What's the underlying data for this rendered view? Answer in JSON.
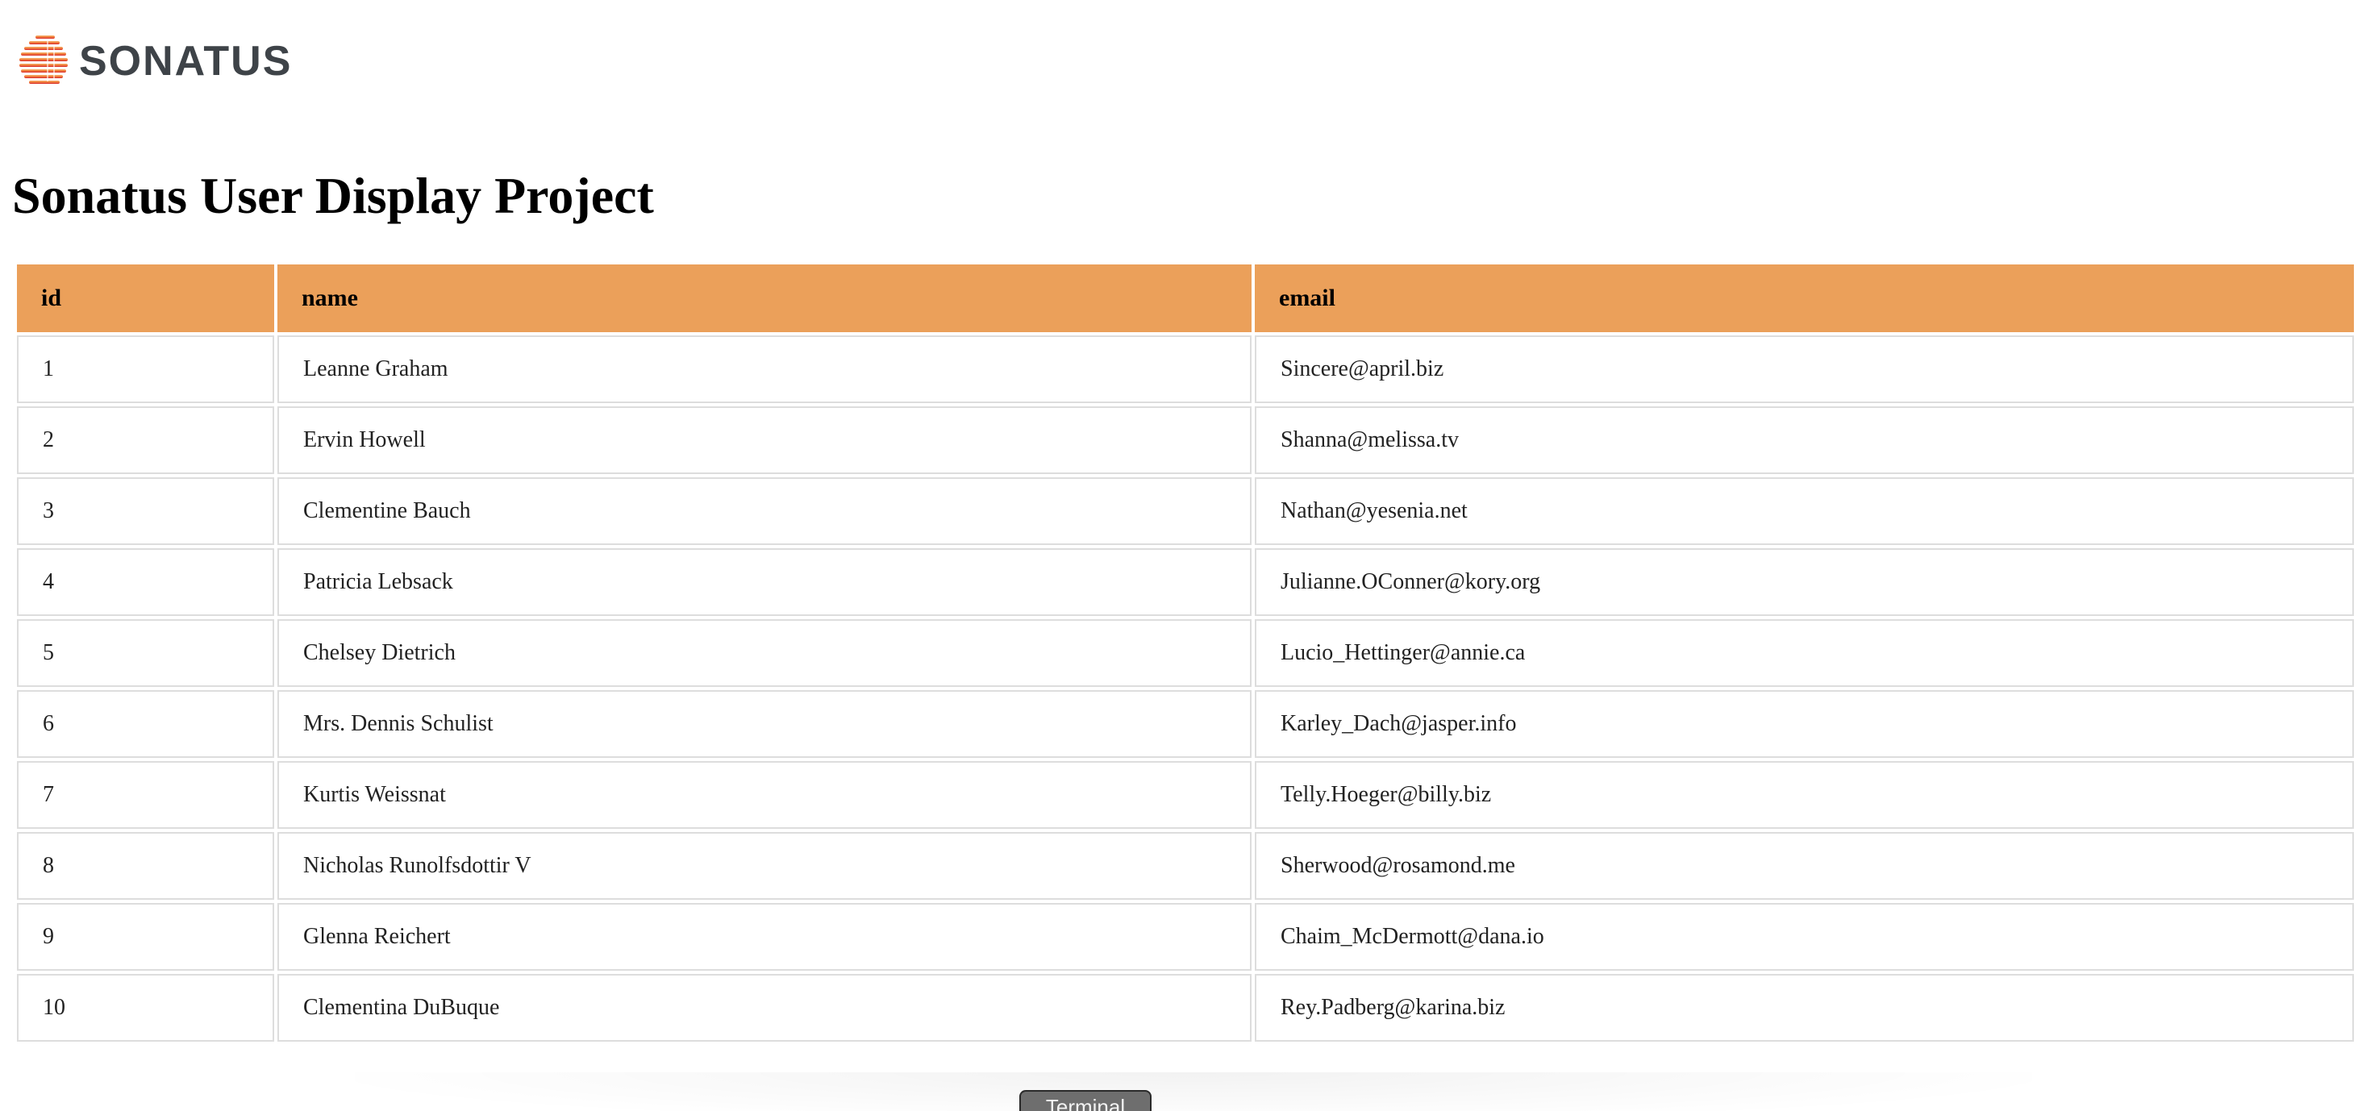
{
  "brand": {
    "name": "SONATUS",
    "colors": {
      "stripe_top": "#f4a05a",
      "stripe_bottom": "#d7262e",
      "wordmark": "#3e4348"
    }
  },
  "page": {
    "title": "Sonatus User Display Project"
  },
  "table": {
    "header_color": "#eba05a",
    "columns": [
      "id",
      "name",
      "email"
    ],
    "rows": [
      {
        "id": "1",
        "name": "Leanne Graham",
        "email": "Sincere@april.biz"
      },
      {
        "id": "2",
        "name": "Ervin Howell",
        "email": "Shanna@melissa.tv"
      },
      {
        "id": "3",
        "name": "Clementine Bauch",
        "email": "Nathan@yesenia.net"
      },
      {
        "id": "4",
        "name": "Patricia Lebsack",
        "email": "Julianne.OConner@kory.org"
      },
      {
        "id": "5",
        "name": "Chelsey Dietrich",
        "email": "Lucio_Hettinger@annie.ca"
      },
      {
        "id": "6",
        "name": "Mrs. Dennis Schulist",
        "email": "Karley_Dach@jasper.info"
      },
      {
        "id": "7",
        "name": "Kurtis Weissnat",
        "email": "Telly.Hoeger@billy.biz"
      },
      {
        "id": "8",
        "name": "Nicholas Runolfsdottir V",
        "email": "Sherwood@rosamond.me"
      },
      {
        "id": "9",
        "name": "Glenna Reichert",
        "email": "Chaim_McDermott@dana.io"
      },
      {
        "id": "10",
        "name": "Clementina DuBuque",
        "email": "Rey.Padberg@karina.biz"
      }
    ]
  },
  "terminal": {
    "label": "Terminal"
  }
}
